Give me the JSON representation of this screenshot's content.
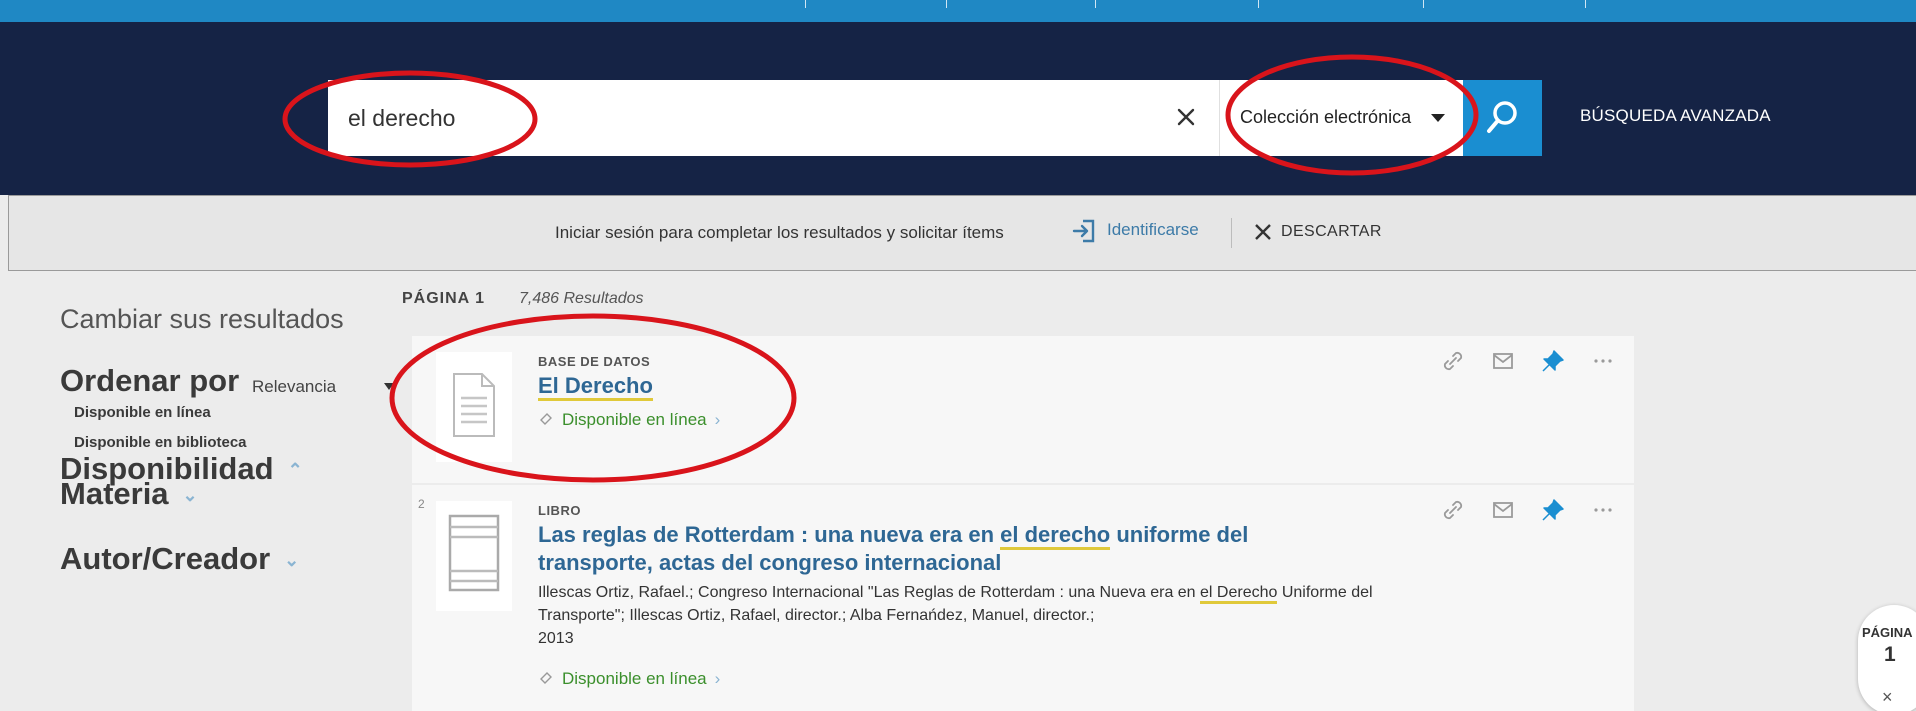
{
  "search": {
    "query": "el derecho",
    "scope": "Colección electrónica",
    "advanced_link": "BÚSQUEDA AVANZADA"
  },
  "login_bar": {
    "message": "Iniciar sesión para completar los resultados y solicitar ítems",
    "signin": "Identificarse",
    "dismiss": "DESCARTAR"
  },
  "facets": {
    "title": "Cambiar sus resultados",
    "sort_label": "Ordenar por",
    "sort_value": "Relevancia",
    "availability": {
      "label": "Disponibilidad",
      "options": [
        "Disponible en línea",
        "Disponible en biblioteca"
      ]
    },
    "subject": "Materia",
    "author": "Autor/Creador"
  },
  "results": {
    "page_label": "PÁGINA 1",
    "count": "7,486 Resultados",
    "items": [
      {
        "type": "BASE DE DATOS",
        "title": "El Derecho",
        "availability": "Disponible en línea"
      },
      {
        "index": "2",
        "type": "LIBRO",
        "title_pre": "Las reglas de Rotterdam : una nueva era en ",
        "title_hl": "el derecho",
        "title_post": " uniforme del",
        "title_line2": "transporte, actas del congreso internacional",
        "authors_pre": "Illescas Ortiz, Rafael.; Congreso Internacional \"Las Reglas de Rotterdam : una Nueva era en ",
        "authors_hl": "el Derecho",
        "authors_post": " Uniforme del",
        "authors_line2": "Transporte\"; Illescas Ortiz, Rafael, director.; Alba Fernańdez, Manuel, director.;",
        "year": "2013",
        "availability": "Disponible en línea"
      }
    ]
  },
  "page_widget": {
    "label": "PÁGINA",
    "number": "1",
    "close": "×"
  },
  "colors": {
    "header_bg": "#152345",
    "top_strip": "#1f88c4",
    "search_button": "#1a8ed1",
    "link_blue": "#2e6794",
    "available_green": "#3b8f2c",
    "annotation_red": "#d9141b",
    "highlight_yellow": "#e0c93a"
  },
  "icons": [
    "close-icon",
    "chevron-down-icon",
    "search-icon",
    "sign-in-icon",
    "link-icon",
    "mail-icon",
    "pin-icon",
    "more-icon",
    "document-icon",
    "book-icon"
  ]
}
